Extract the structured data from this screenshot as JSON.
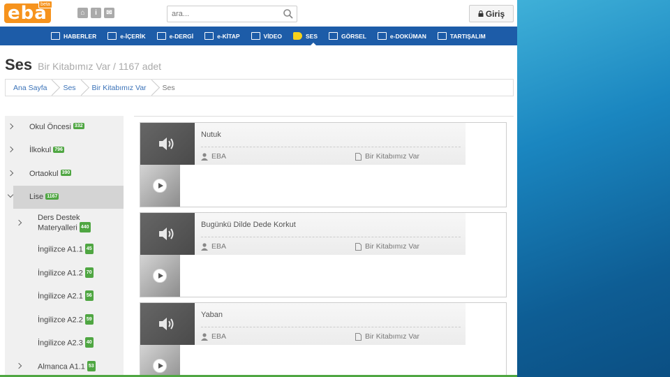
{
  "header": {
    "logo_text": "eba",
    "logo_badge": "beta",
    "search_placeholder": "ara...",
    "login_label": "Giriş"
  },
  "nav": {
    "items": [
      {
        "label": "HABERLER",
        "icon": "news-icon"
      },
      {
        "label": "e-İÇERİK",
        "icon": "content-icon"
      },
      {
        "label": "e-DERGİ",
        "icon": "magazine-icon"
      },
      {
        "label": "e-KİTAP",
        "icon": "book-icon"
      },
      {
        "label": "VİDEO",
        "icon": "video-icon"
      },
      {
        "label": "SES",
        "icon": "speaker-icon",
        "active": true
      },
      {
        "label": "GÖRSEL",
        "icon": "image-icon"
      },
      {
        "label": "e-DOKÜMAN",
        "icon": "document-icon"
      },
      {
        "label": "TARTIŞALIM",
        "icon": "discussion-icon"
      }
    ]
  },
  "title": {
    "main": "Ses",
    "sub": "Bir Kitabımız Var / 1167 adet"
  },
  "breadcrumb": [
    "Ana Sayfa",
    "Ses",
    "Bir Kitabımız Var",
    "Ses"
  ],
  "categories": [
    {
      "label": "Okul Öncesi",
      "count": "332"
    },
    {
      "label": "İlkokul",
      "count": "796"
    },
    {
      "label": "Ortaokul",
      "count": "390"
    },
    {
      "label": "Lise",
      "count": "1167"
    },
    {
      "label": "Ders Destek",
      "label2": "Materyalleri",
      "count": "440"
    },
    {
      "label": "İngilizce A1.1",
      "count": "45"
    },
    {
      "label": "İngilizce A1.2",
      "count": "70"
    },
    {
      "label": "İngilizce A2.1",
      "count": "56"
    },
    {
      "label": "İngilizce A2.2",
      "count": "59"
    },
    {
      "label": "İngilizce A2.3",
      "count": "40"
    },
    {
      "label": "Almanca A1.1",
      "count": "53"
    }
  ],
  "cards": [
    {
      "title": "Nutuk",
      "author": "EBA",
      "collection": "Bir Kitabımız Var"
    },
    {
      "title": "Bugünkü Dilde Dede Korkut",
      "author": "EBA",
      "collection": "Bir Kitabımız Var"
    },
    {
      "title": "Yaban",
      "author": "EBA",
      "collection": "Bir Kitabımız Var"
    }
  ],
  "colors": {
    "brand_orange": "#f6931d",
    "nav_blue": "#1d5ca8",
    "badge_green": "#4fa642",
    "link_blue": "#3a72b8"
  }
}
